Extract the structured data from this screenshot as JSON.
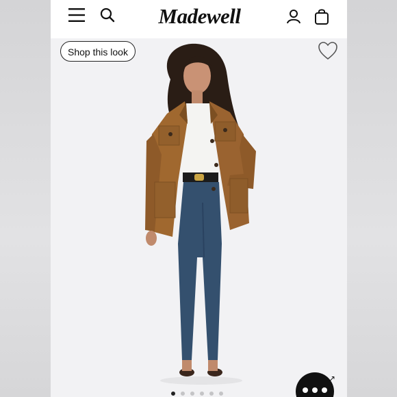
{
  "header": {
    "brand": "Madewell",
    "icons": [
      "menu-icon",
      "search-icon",
      "account-icon",
      "bag-icon"
    ]
  },
  "product": {
    "shop_look_label": "Shop this look",
    "favorite_icon": "heart-icon"
  },
  "carousel": {
    "slide_count": 6,
    "active_index": 0
  },
  "colors": {
    "background": "#f2f2f4",
    "jacket": "#a0682f",
    "denim": "#34506e",
    "accent": "#111111"
  }
}
